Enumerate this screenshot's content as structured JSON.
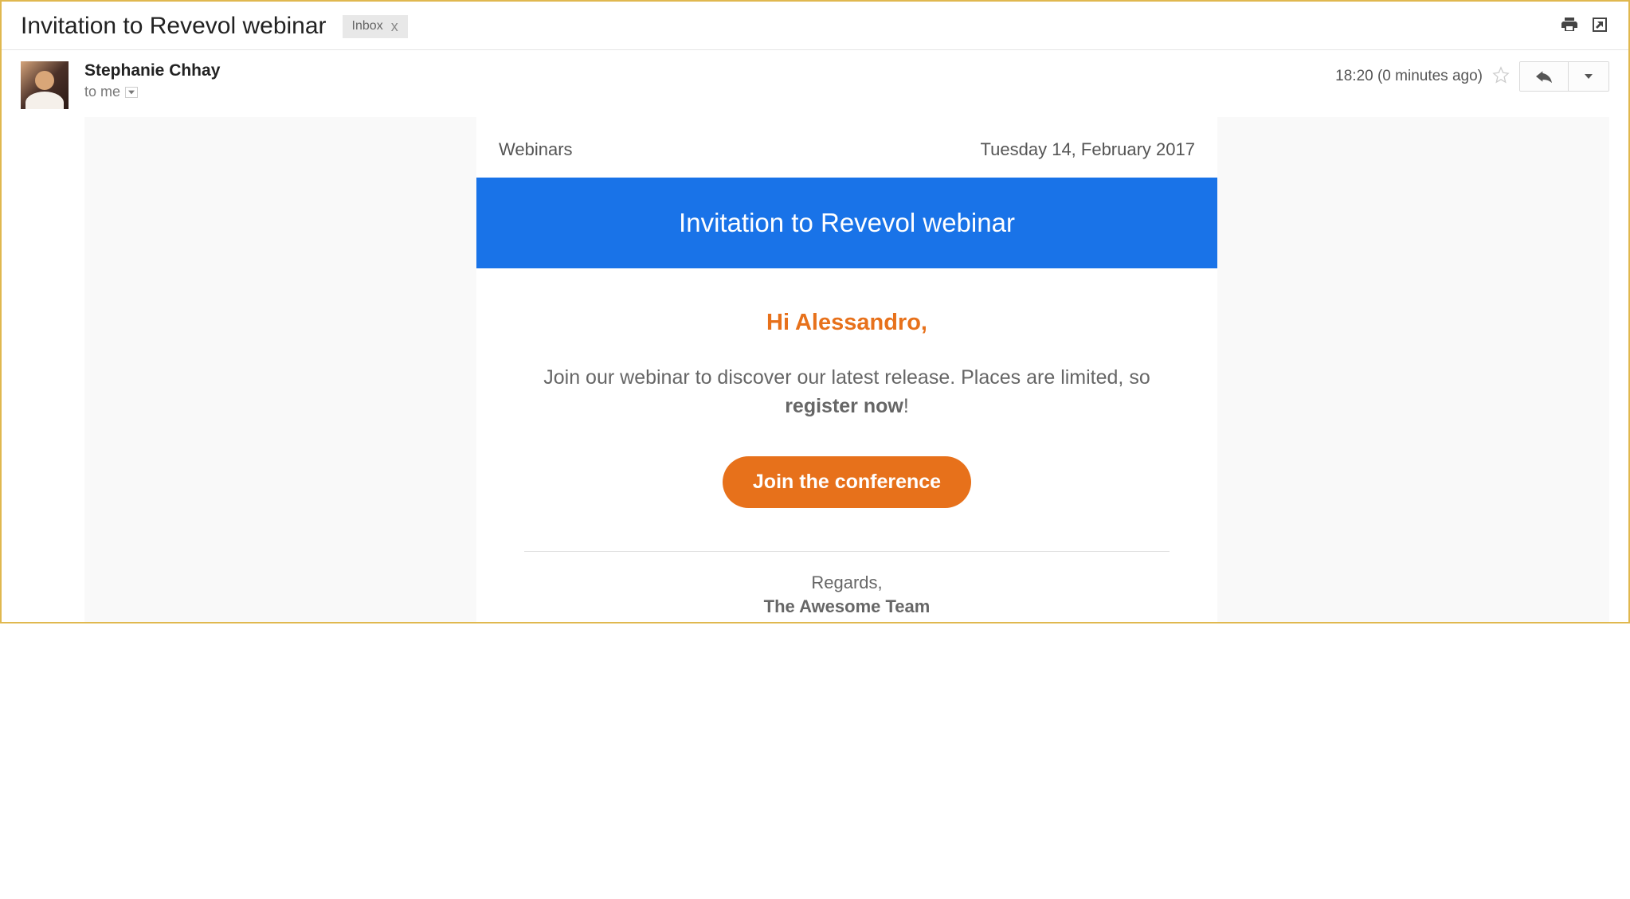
{
  "header": {
    "subject": "Invitation to Revevol webinar",
    "label": "Inbox"
  },
  "message": {
    "sender": "Stephanie Chhay",
    "recipient": "to me",
    "timestamp": "18:20 (0 minutes ago)"
  },
  "mail": {
    "category": "Webinars",
    "date": "Tuesday 14, February 2017",
    "banner": "Invitation to Revevol webinar",
    "greeting": "Hi Alessandro,",
    "body_pre": "Join our webinar to discover our latest release. Places are limited, so ",
    "body_bold": "register now",
    "body_post": "!",
    "cta": "Join the conference",
    "signature_regards": "Regards,",
    "signature_team": "The Awesome Team"
  }
}
